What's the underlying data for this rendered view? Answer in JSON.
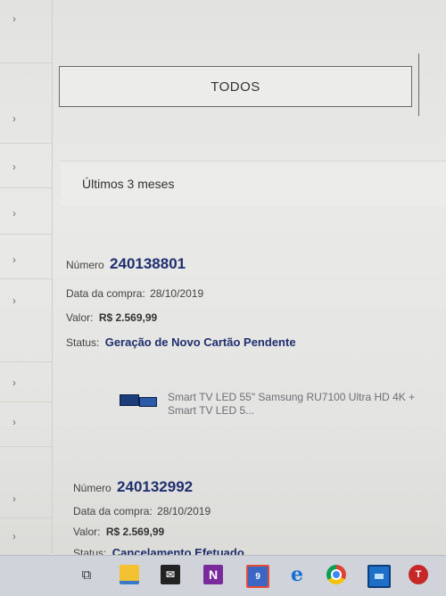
{
  "filter": {
    "todos_label": "TODOS"
  },
  "period": {
    "label": "Últimos 3 meses"
  },
  "orders": [
    {
      "numero_label": "Número",
      "numero": "240138801",
      "data_label": "Data da compra:",
      "data": "28/10/2019",
      "valor_label": "Valor:",
      "valor": "R$ 2.569,99",
      "status_label": "Status:",
      "status": "Geração de Novo Cartão Pendente",
      "product": "Smart TV LED 55\" Samsung RU7100 Ultra HD 4K + Smart TV LED 5..."
    },
    {
      "numero_label": "Número",
      "numero": "240132992",
      "data_label": "Data da compra:",
      "data": "28/10/2019",
      "valor_label": "Valor:",
      "valor": "R$ 2.569,99",
      "status_label": "Status:",
      "status": "Cancelamento Efetuado"
    }
  ],
  "taskbar": {
    "icons": [
      "task-view-icon",
      "file-explorer-icon",
      "mail-icon",
      "onenote-icon",
      "photos-icon",
      "edge-icon",
      "chrome-icon",
      "remote-desktop-icon",
      "app-icon"
    ],
    "onenote_letter": "N",
    "edge_letter": "e",
    "app_letter": "T",
    "badge": "9"
  },
  "colors": {
    "accent": "#1f2f6e",
    "background": "#e6e6e4"
  }
}
